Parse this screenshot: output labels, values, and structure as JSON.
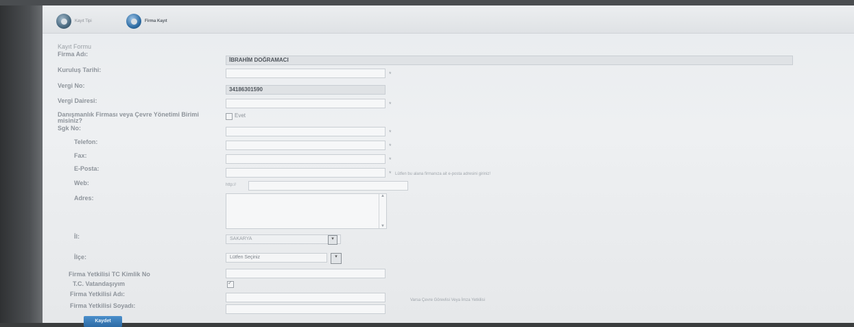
{
  "steps": [
    {
      "label": "Kayıt Tipi",
      "active": false
    },
    {
      "label": "Firma Kayıt",
      "active": true
    }
  ],
  "form": {
    "title": "Kayıt Formu",
    "fields": {
      "firma_adi": {
        "label": "Firma Adı:",
        "value": "İBRAHİM DOĞRAMACI"
      },
      "kurulus_tarihi": {
        "label": "Kuruluş Tarihi:",
        "value": "",
        "required": "*"
      },
      "vergi_no": {
        "label": "Vergi No:",
        "value": "34186301590"
      },
      "vergi_dairesi": {
        "label": "Vergi Dairesi:",
        "value": "",
        "required": "*"
      },
      "danismanlik": {
        "label": "Danışmanlık Firması veya Çevre Yönetimi Birimi misiniz?",
        "checkbox_label": "Evet"
      },
      "sgk_no": {
        "label": "Sgk No:",
        "value": "",
        "required": "*"
      },
      "telefon": {
        "label": "Telefon:",
        "value": "",
        "required": "*"
      },
      "fax": {
        "label": "Fax:",
        "value": "",
        "required": "*"
      },
      "eposta": {
        "label": "E-Posta:",
        "value": "",
        "required": "*",
        "hint": "Lütfen bu alana firmanıza ait e-posta adresini giriniz!"
      },
      "web": {
        "label": "Web:",
        "prefix": "http://",
        "value": ""
      },
      "adres": {
        "label": "Adres:",
        "value": ""
      },
      "il": {
        "label": "İl:",
        "value": "SAKARYA"
      },
      "ilce": {
        "label": "İlçe:",
        "value": "Lütfen Seçiniz"
      },
      "yetkili_tc": {
        "label": "Firma Yetkilisi TC Kimlik No",
        "value": ""
      },
      "tc_vatandas": {
        "label": "T.C. Vatandaşıyım",
        "checked": true
      },
      "yetkili_adi": {
        "label": "Firma Yetkilisi Adı:",
        "value": ""
      },
      "yetkili_soyadi": {
        "label": "Firma Yetkilisi Soyadı:",
        "value": "",
        "hint": "Varsa Çevre Görevlisi Veya İmza Yetkilisi"
      }
    },
    "submit_label": "Kaydet"
  }
}
